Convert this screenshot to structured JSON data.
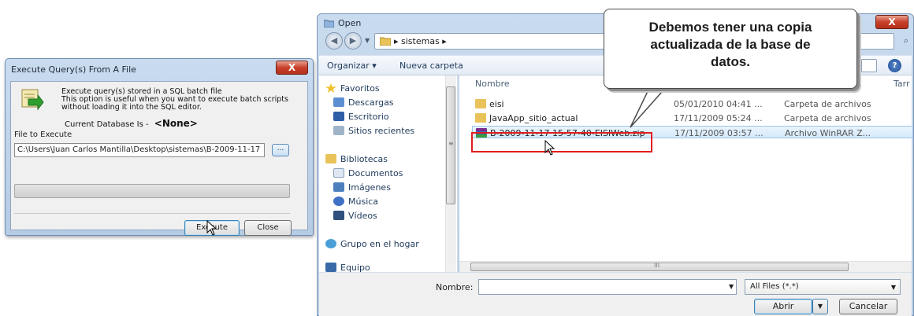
{
  "exec_dialog": {
    "title": "Execute Query(s) From A File",
    "close_label": "X",
    "desc_lines": [
      "Execute query(s) stored in a SQL batch file",
      "This option is useful when you want to execute batch scripts",
      "without loading it into the SQL editor."
    ],
    "current_db_label": "Current Database Is -",
    "current_db_value": "<None>",
    "file_label": "File to Execute",
    "file_path": "C:\\Users\\Juan Carlos Mantilla\\Desktop\\sistemas\\B-2009-11-17",
    "browse_label": "...",
    "execute_label": "Execute",
    "close_button_label": "Close"
  },
  "open_dialog": {
    "title": "Open",
    "close_label": "X",
    "breadcrumb": "▸ sistemas ▸",
    "toolbar": {
      "organize": "Organizar ▾",
      "new_folder": "Nueva carpeta"
    },
    "nav": {
      "favorites": "Favoritos",
      "items_fav": [
        "Descargas",
        "Escritorio",
        "Sitios recientes"
      ],
      "libraries": "Bibliotecas",
      "items_lib": [
        "Documentos",
        "Imágenes",
        "Música",
        "Vídeos"
      ],
      "homegroup": "Grupo en el hogar",
      "computer": "Equipo"
    },
    "columns": {
      "name": "Nombre",
      "truncated": "Tarr"
    },
    "files": [
      {
        "name": "eisi",
        "date": "05/01/2010 04:41 ...",
        "type": "Carpeta de archivos"
      },
      {
        "name": "JavaApp_sitio_actual",
        "date": "17/11/2009 05:24 ...",
        "type": "Carpeta de archivos"
      },
      {
        "name": "B-2009-11-17 15-57-40-EISIWeb.zip",
        "date": "17/11/2009 03:57 ...",
        "type": "Archivo WinRAR Z..."
      }
    ],
    "filename_label": "Nombre:",
    "filename_value": "",
    "filter": "All Files (*.*)",
    "open_button": "Abrir",
    "cancel_button": "Cancelar",
    "scroll_grip": "III"
  },
  "callout": {
    "lines": [
      "Debemos tener una copia",
      "actualizada de la base de",
      "datos."
    ]
  },
  "colors": {
    "title_bar": "#c9dbee",
    "close_red": "#c7402a",
    "highlight_border": "#e21d1d",
    "selection": "#d5e9fb"
  }
}
